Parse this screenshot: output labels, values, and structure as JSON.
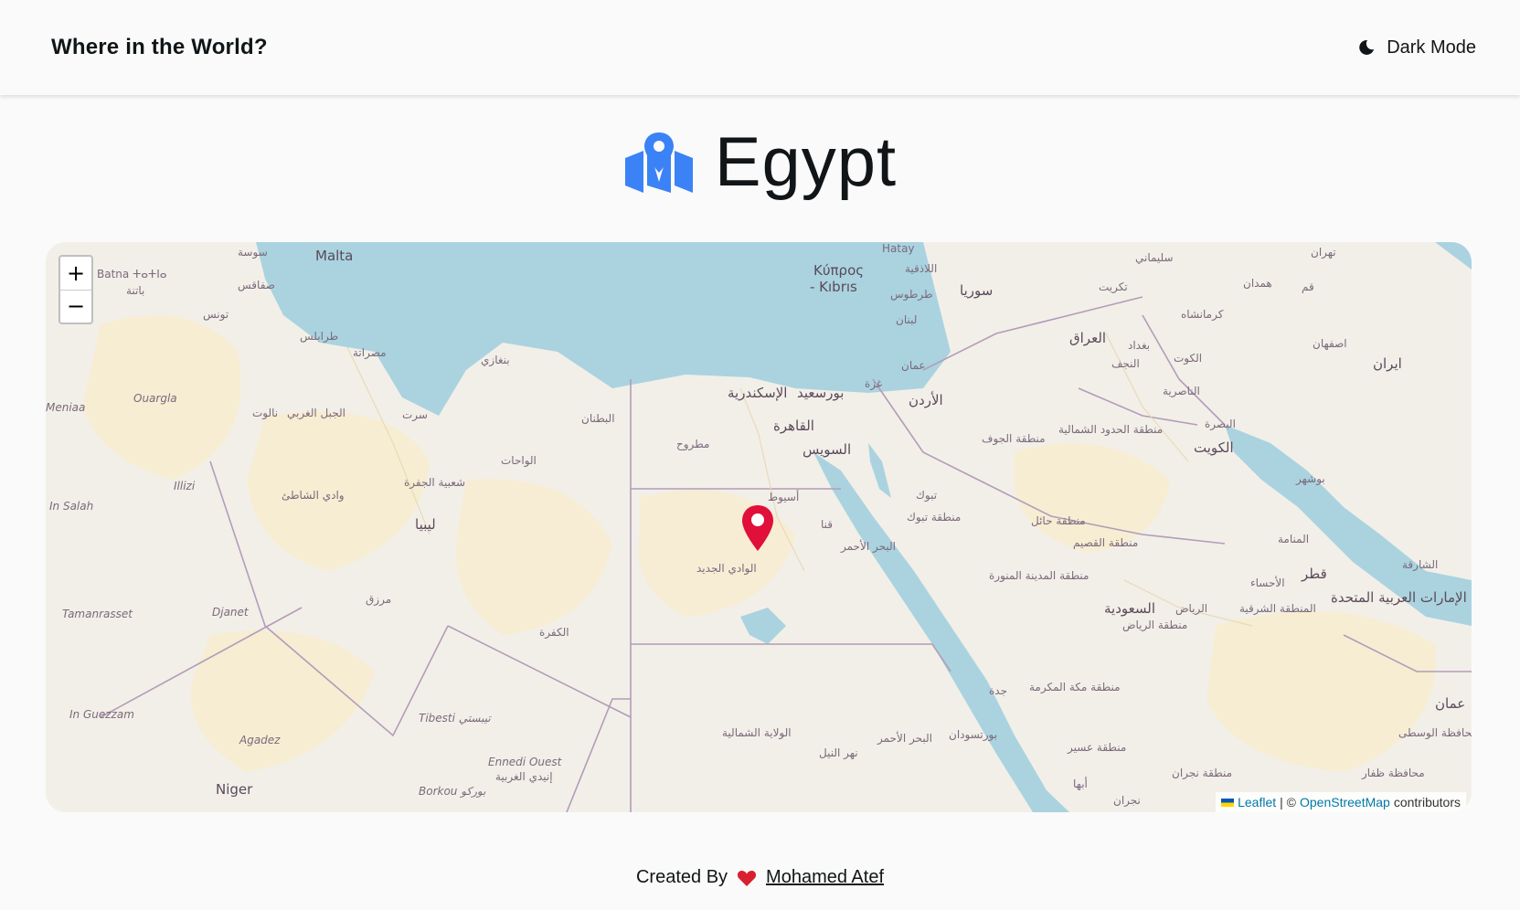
{
  "header": {
    "title": "Where in the World?",
    "mode_label": "Dark Mode",
    "mode_icon": "moon-icon"
  },
  "page": {
    "country": "Egypt",
    "title_icon": "map-location-icon",
    "accent_color": "#3b82f6"
  },
  "map": {
    "zoom_in": "+",
    "zoom_out": "−",
    "marker_color": "#e0103a",
    "labels": {
      "malta": "Malta",
      "kypros": "Κύπρος",
      "kibris": "- Kıbrıs",
      "hatay": "Hatay",
      "batna": "Batna ⵜⴰⵜⵏⴰ",
      "batna_ar": "باتنة",
      "sousse": "سوسة",
      "sfax": "صفاقس",
      "tunis": "تونس",
      "tripoli": "طرابلس",
      "misrata": "مصراتة",
      "benghazi": "بنغازي",
      "ouargla": "Ouargla",
      "meniaa": "Meniaa",
      "nalut": "نالوت",
      "jabal": "الجبل الغربي",
      "sirte": "سرت",
      "butnan": "البطنان",
      "wahat": "الواحات",
      "matruh": "مطروح",
      "alexandria": "الإسكندرية",
      "portsaid": "بورسعيد",
      "cairo": "القاهرة",
      "suez": "السويس",
      "gaza": "غزة",
      "amman": "عمان",
      "jordan": "الأردن",
      "lebanon": "لبنان",
      "tartus": "طرطوس",
      "latakia": "اللاذقية",
      "syria": "سوريا",
      "iraq": "العراق",
      "baghdad": "بغداد",
      "najaf": "النجف",
      "kut": "الكوت",
      "nasiriyah": "الناصرية",
      "basra": "البصرة",
      "kuwait": "الكويت",
      "iran": "ایران",
      "isfahan": "اصفهان",
      "kermanshah": "کرمانشاه",
      "hamadan": "همدان",
      "qom": "قم",
      "tehran": "تهران",
      "tikrit": "تكريت",
      "sulaymaniyah": "سليماني",
      "illizi": "Illizi",
      "insalah": "In Salah",
      "wadishati": "وادي الشاطئ",
      "jufrah": "شعبية الجفرة",
      "libya": "ليبيا",
      "asyut": "أسيوط",
      "qena": "قنا",
      "redsea": "البحر الأحمر",
      "newvalley": "الوادي الجديد",
      "tabuk": "تبوك",
      "tabukreg": "منطقة تبوك",
      "jawf": "منطقة الجوف",
      "northern": "منطقة الحدود الشمالية",
      "hail": "منطقة حائل",
      "qassim": "منطقة القصيم",
      "madinah": "منطقة المدينة المنورة",
      "saudi": "السعودية",
      "riyadh": "الرياض",
      "riyadhreg": "منطقة الرياض",
      "eastern": "المنطقة الشرقية",
      "ahsa": "الأحساء",
      "manama": "المنامة",
      "qatar": "قطر",
      "uae": "الإمارات العربية المتحدة",
      "sharjah": "الشارقة",
      "bushehr": "بوشهر",
      "tamanrasset": "Tamanrasset",
      "djanet": "Djanet",
      "murzuq": "مرزق",
      "kufra": "الكفرة",
      "inguezzam": "In Guezzam",
      "agadez": "Agadez",
      "niger": "Niger",
      "tibesti": "Tibesti تيبستي",
      "ennedi": "Ennedi Ouest",
      "ennedi_ar": "إنيدي الغربية",
      "borkou": "Borkou بوركو",
      "northernsd": "الولاية الشمالية",
      "nile": "نهر النيل",
      "redseasd": "البحر الأحمر",
      "portsudan": "بورتسودان",
      "jeddah": "جدة",
      "makkah": "منطقة مكة المكرمة",
      "asir": "منطقة عسير",
      "abha": "أبها",
      "najran": "منطقة نجران",
      "najrancity": "نجران",
      "dhofar": "محافظة ظفار",
      "wusta": "محافظة الوسطى",
      "oman": "عمان"
    }
  },
  "attribution": {
    "leaflet": "Leaflet",
    "sep": "| ©",
    "osm": "OpenStreetMap",
    "contrib": "contributors"
  },
  "footer": {
    "created_by": "Created By",
    "author": "Mohamed Atef",
    "heart_color": "#d9202e"
  }
}
